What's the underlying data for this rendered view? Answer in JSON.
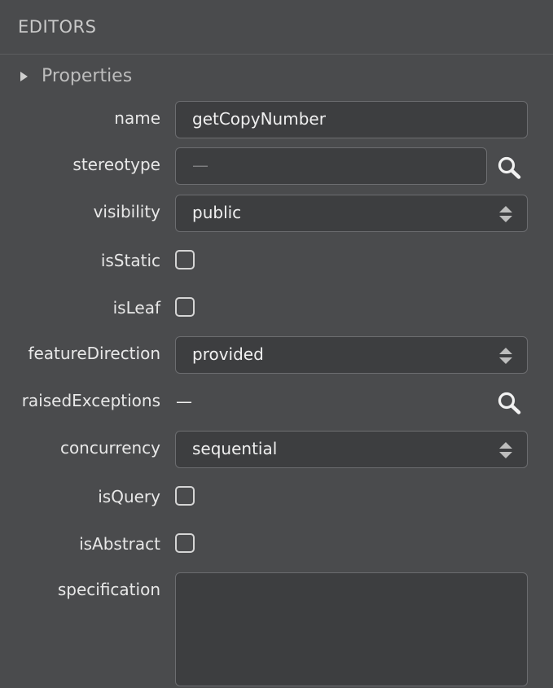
{
  "panel": {
    "title": "EDITORS"
  },
  "section": {
    "title": "Properties"
  },
  "fields": {
    "name": {
      "label": "name",
      "value": "getCopyNumber"
    },
    "stereotype": {
      "label": "stereotype",
      "placeholder": "—"
    },
    "visibility": {
      "label": "visibility",
      "value": "public"
    },
    "isStatic": {
      "label": "isStatic",
      "checked": false
    },
    "isLeaf": {
      "label": "isLeaf",
      "checked": false
    },
    "featureDirection": {
      "label": "featureDirection",
      "value": "provided"
    },
    "raisedExceptions": {
      "label": "raisedExceptions",
      "value": "—"
    },
    "concurrency": {
      "label": "concurrency",
      "value": "sequential"
    },
    "isQuery": {
      "label": "isQuery",
      "checked": false
    },
    "isAbstract": {
      "label": "isAbstract",
      "checked": false
    },
    "specification": {
      "label": "specification",
      "value": ""
    }
  },
  "icons": {
    "search": "search-icon",
    "select": "select-arrows-icon",
    "expand": "triangle-right-icon"
  }
}
